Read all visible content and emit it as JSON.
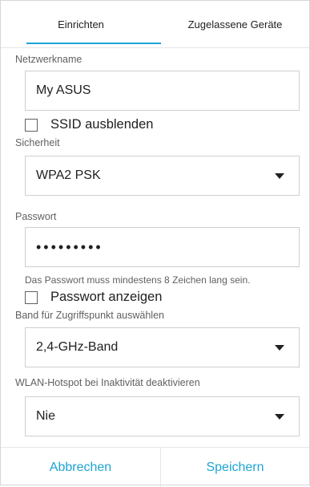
{
  "tabs": [
    {
      "label": "Einrichten",
      "active": true
    },
    {
      "label": "Zugelassene Geräte",
      "active": false
    }
  ],
  "network_name": {
    "label": "Netzwerkname",
    "value": "My ASUS"
  },
  "hide_ssid": {
    "label": "SSID ausblenden",
    "checked": false
  },
  "security": {
    "label": "Sicherheit",
    "value": "WPA2 PSK"
  },
  "password": {
    "label": "Passwort",
    "value": "•••••••••",
    "hint": "Das Passwort muss mindestens 8 Zeichen lang sein.",
    "show_label": "Passwort anzeigen",
    "show_checked": false
  },
  "band": {
    "label": "Band für Zugriffspunkt auswählen",
    "value": "2,4-GHz-Band"
  },
  "inactivity": {
    "label": "WLAN-Hotspot bei Inaktivität deaktivieren",
    "value": "Nie"
  },
  "footer": {
    "cancel": "Abbrechen",
    "save": "Speichern"
  },
  "colors": {
    "accent": "#1ea5d4"
  },
  "icons": {
    "dropdown": "caret-down-icon"
  }
}
